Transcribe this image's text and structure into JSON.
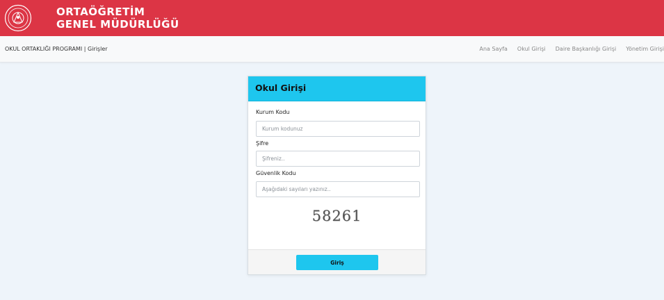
{
  "header": {
    "title_line1": "ORTAÖĞRETİM",
    "title_line2": "GENEL MÜDÜRLÜĞÜ",
    "logo_icon": "ministry-seal-icon",
    "color": "#dc3545"
  },
  "navbar": {
    "breadcrumb": "OKUL ORTAKLIĞI PROGRAMI | Girişler",
    "links": [
      "Ana Sayfa",
      "Okul Girişi",
      "Daire Başkanlığı Girişi",
      "Yönetim Girişi"
    ]
  },
  "login": {
    "title": "Okul Girişi",
    "accent_color": "#1ec6ee",
    "institution_code_label": "Kurum Kodu",
    "institution_code_placeholder": "Kurum kodunuz",
    "institution_code_value": "",
    "password_label": "Şifre",
    "password_placeholder": "Şifreniz..",
    "password_value": "",
    "security_code_label": "Güvenlik Kodu",
    "security_code_placeholder": "Aşağıdaki sayıları yazınız..",
    "security_code_value": "",
    "captcha": "58261",
    "submit_label": "Giriş"
  }
}
